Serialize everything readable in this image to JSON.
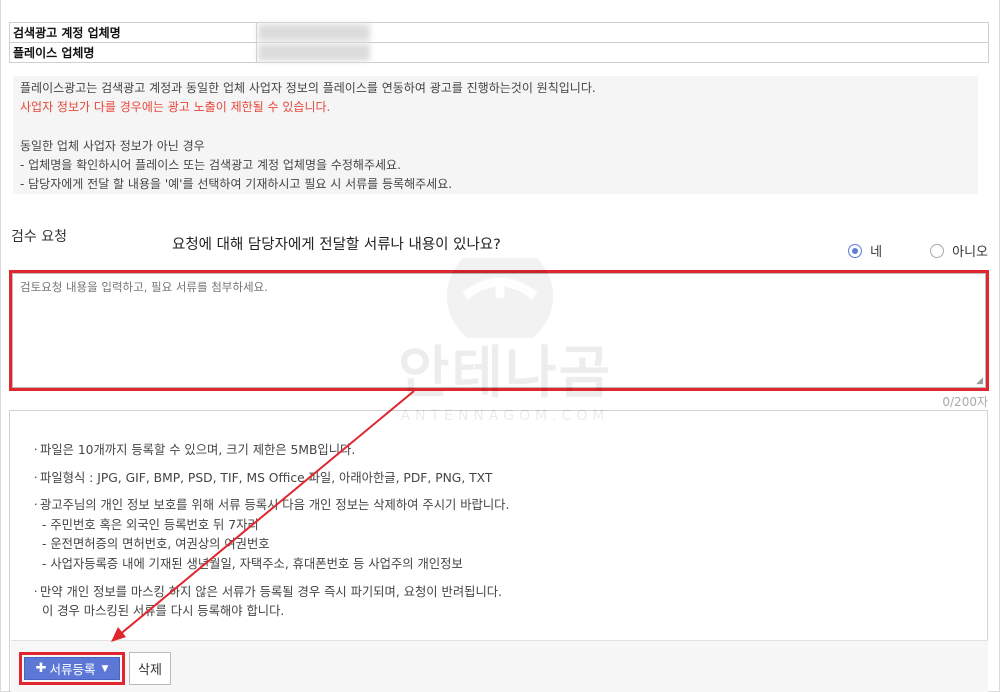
{
  "account": {
    "rows": [
      {
        "label": "검색광고 계정 업체명"
      },
      {
        "label": "플레이스 업체명"
      }
    ]
  },
  "info": {
    "line1": "플레이스광고는 검색광고 계정과 동일한 업체 사업자 정보의 플레이스를 연동하여 광고를 진행하는것이 원칙입니다.",
    "line2_red": "사업자 정보가 다를 경우에는 광고 노출이 제한될 수 있습니다.",
    "line3": "동일한 업체 사업자 정보가 아닌 경우",
    "line4": "- 업체명을 확인하시어 플레이스 또는 검색광고 계정 업체명을 수정해주세요.",
    "line5": "- 담당자에게 전달 할 내용을 '예'를 선택하여 기재하시고 필요 시 서류를 등록해주세요."
  },
  "review": {
    "label": "검수 요청",
    "question": "요청에 대해 담당자에게 전달할 서류나 내용이 있나요?",
    "options": [
      {
        "label": "네",
        "selected": true
      },
      {
        "label": "아니오",
        "selected": false
      }
    ],
    "placeholder": "검토요청 내용을 입력하고, 필요 서류를 첨부하세요.",
    "counter": "0/200자"
  },
  "notice": {
    "bullet": "ㆍ",
    "items": [
      "파일은 10개까지 등록할 수 있으며, 크기 제한은 5MB입니다.",
      "파일형식 : JPG, GIF, BMP, PSD, TIF, MS Office 파일, 아래아한글, PDF, PNG, TXT",
      "광고주님의 개인 정보 보호를 위해 서류 등록시 다음 개인 정보는 삭제하여 주시기 바랍니다.",
      "만약 개인 정보를 마스킹 하지 않은 서류가 등록될 경우 즉시 파기되며, 요청이 반려됩니다."
    ],
    "sub_items": [
      "- 주민번호 혹은 외국인 등록번호 뒤 7자리",
      "- 운전면허증의 면허번호, 여권상의 여권번호",
      "- 사업자등록증 내에 기재된 생년월일, 자택주소, 휴대폰번호 등 사업주의 개인정보"
    ],
    "last_sub": "이 경우 마스킹된 서류를 다시 등록해야 합니다."
  },
  "buttons": {
    "register": "서류등록",
    "delete": "삭제"
  },
  "watermark": {
    "text": "안테나곰",
    "sub": "ANTENNAGOM.COM"
  },
  "colors": {
    "accent": "#5c77d6",
    "highlight": "#e0262e",
    "warning_text": "#e8473b"
  },
  "icons": {
    "plus": "plus-icon",
    "chevron": "chevron-down-icon",
    "resize": "resize-grip-icon"
  }
}
